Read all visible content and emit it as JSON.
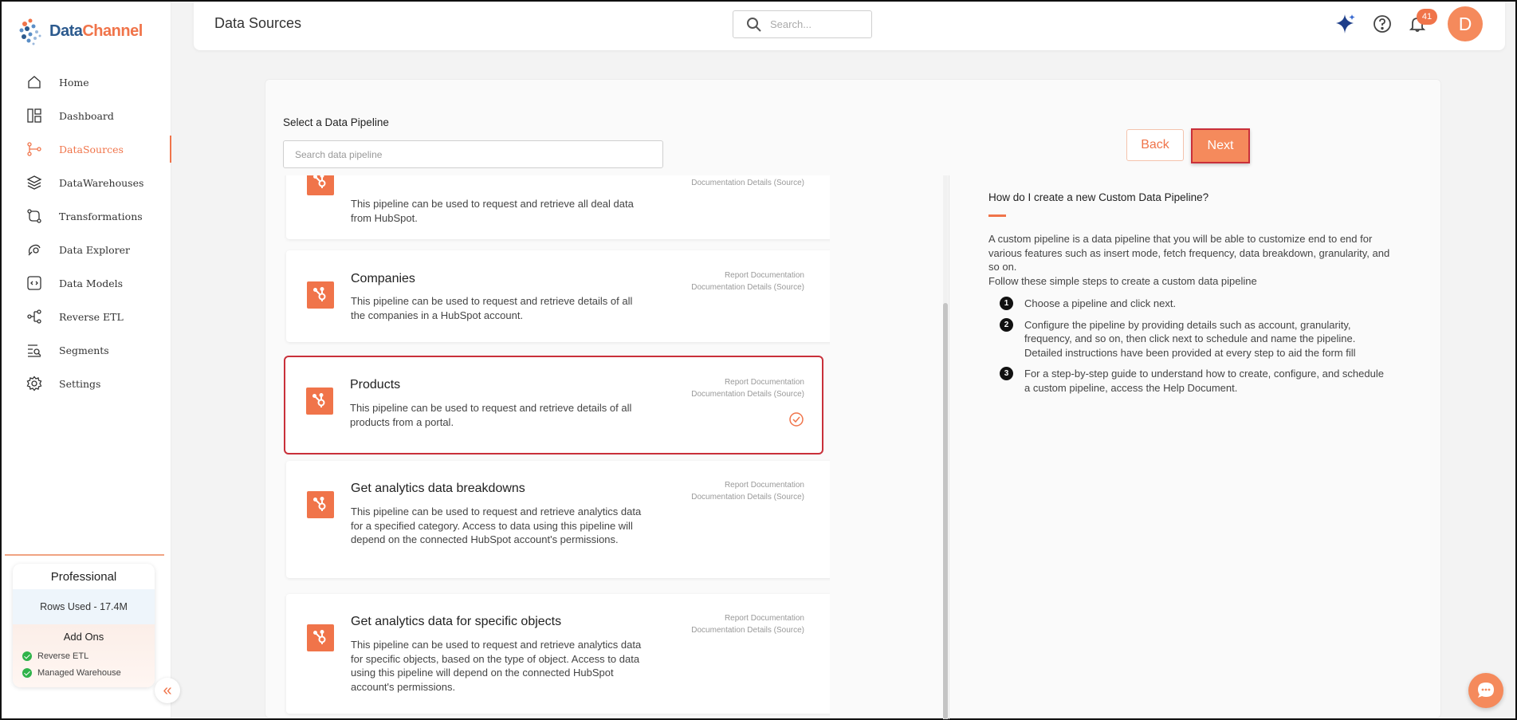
{
  "brand": {
    "name_part1": "Data",
    "name_part2": "Channel",
    "accent": "#f0744a"
  },
  "sidebar": {
    "items": [
      {
        "label": "Home",
        "icon": "home-icon"
      },
      {
        "label": "Dashboard",
        "icon": "dashboard-icon"
      },
      {
        "label": "DataSources",
        "icon": "datasources-icon",
        "active": true
      },
      {
        "label": "DataWarehouses",
        "icon": "datawarehouses-icon"
      },
      {
        "label": "Transformations",
        "icon": "transformations-icon"
      },
      {
        "label": "Data Explorer",
        "icon": "data-explorer-icon"
      },
      {
        "label": "Data Models",
        "icon": "data-models-icon"
      },
      {
        "label": "Reverse ETL",
        "icon": "reverse-etl-icon"
      },
      {
        "label": "Segments",
        "icon": "segments-icon"
      },
      {
        "label": "Settings",
        "icon": "settings-icon"
      }
    ],
    "plan": {
      "name": "Professional",
      "rows_used": "Rows Used - 17.4M",
      "addons_title": "Add Ons",
      "addons": [
        "Reverse ETL",
        "Managed Warehouse"
      ]
    },
    "collapse_glyph": "«"
  },
  "header": {
    "title": "Data Sources",
    "search_placeholder": "Search...",
    "notifications_count": "41",
    "avatar_initial": "D"
  },
  "main": {
    "select_label": "Select a Data Pipeline",
    "search_placeholder": "Search data pipeline",
    "back_label": "Back",
    "next_label": "Next",
    "pipelines": [
      {
        "title": "",
        "description": "This pipeline can be used to request and retrieve all deal data from HubSpot.",
        "link1": "",
        "link2": "Documentation Details (Source)"
      },
      {
        "title": "Companies",
        "description": "This pipeline can be used to request and retrieve details of all the companies in a HubSpot account.",
        "link1": "Report Documentation",
        "link2": "Documentation Details (Source)"
      },
      {
        "title": "Products",
        "description": "This pipeline can be used to request and retrieve details of all products from a portal.",
        "link1": "Report Documentation",
        "link2": "Documentation Details (Source)",
        "selected": true
      },
      {
        "title": "Get analytics data breakdowns",
        "description": "This pipeline can be used to request and retrieve analytics data for a specified category. Access to data using this pipeline will depend on the connected HubSpot account's permissions.",
        "link1": "Report Documentation",
        "link2": "Documentation Details (Source)"
      },
      {
        "title": "Get analytics data for specific objects",
        "description": "This pipeline can be used to request and retrieve analytics data for specific objects, based on the type of object. Access to data using this pipeline will depend on the connected HubSpot account's permissions.",
        "link1": "Report Documentation",
        "link2": "Documentation Details (Source)"
      }
    ],
    "help": {
      "title": "How do I create a new Custom Data Pipeline?",
      "intro": "A custom pipeline is a data pipeline that you will be able to customize end to end for various features such as insert mode, fetch frequency, data breakdown, granularity, and so on.",
      "intro2": "Follow these simple steps to create a custom data pipeline",
      "steps": [
        {
          "num": "1",
          "text": "Choose a pipeline and click next."
        },
        {
          "num": "2",
          "text": "Configure the pipeline by providing details such as account, granularity, frequency, and so on, then click next to schedule and name the pipeline. Detailed instructions have been provided at every step to aid the form fill"
        },
        {
          "num": "3",
          "text": "For a step-by-step guide to understand how to create, configure, and schedule a custom pipeline, access the Help Document."
        }
      ]
    }
  }
}
